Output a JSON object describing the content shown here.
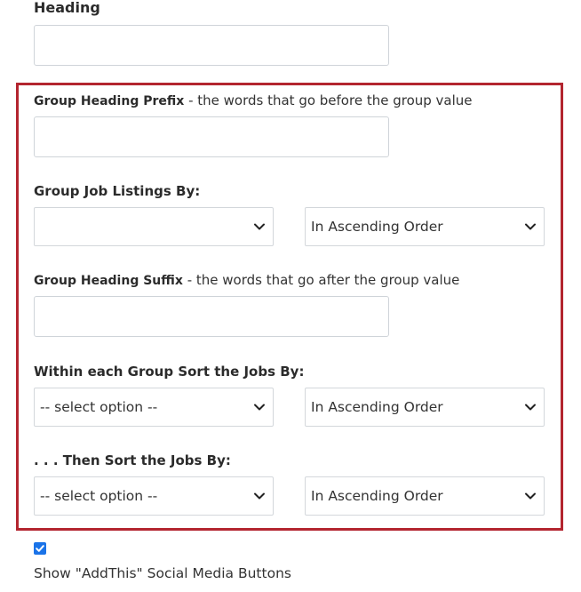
{
  "heading": {
    "label": "Heading",
    "value": ""
  },
  "group_heading_prefix": {
    "label_bold": "Group Heading Prefix",
    "label_rest": " - the words that go before the group value",
    "value": ""
  },
  "group_job_listings": {
    "label": "Group Job Listings By:",
    "field_value": "",
    "order_value": "In Ascending Order"
  },
  "group_heading_suffix": {
    "label_bold": "Group Heading Suffix",
    "label_rest": " - the words that go after the group value",
    "value": ""
  },
  "within_group_sort": {
    "label": "Within each Group Sort the Jobs By:",
    "field_value": "-- select option --",
    "order_value": "In Ascending Order"
  },
  "then_sort": {
    "label": ". . . Then Sort the Jobs By:",
    "field_value": "-- select option --",
    "order_value": "In Ascending Order"
  },
  "addthis": {
    "checked": true,
    "label": "Show \"AddThis\" Social Media Buttons"
  },
  "colors": {
    "highlight_border": "#b3252f",
    "checkbox": "#1a73e8"
  },
  "icons": {
    "select_arrow": "chevron-down-icon",
    "checkbox_mark": "check-icon"
  }
}
